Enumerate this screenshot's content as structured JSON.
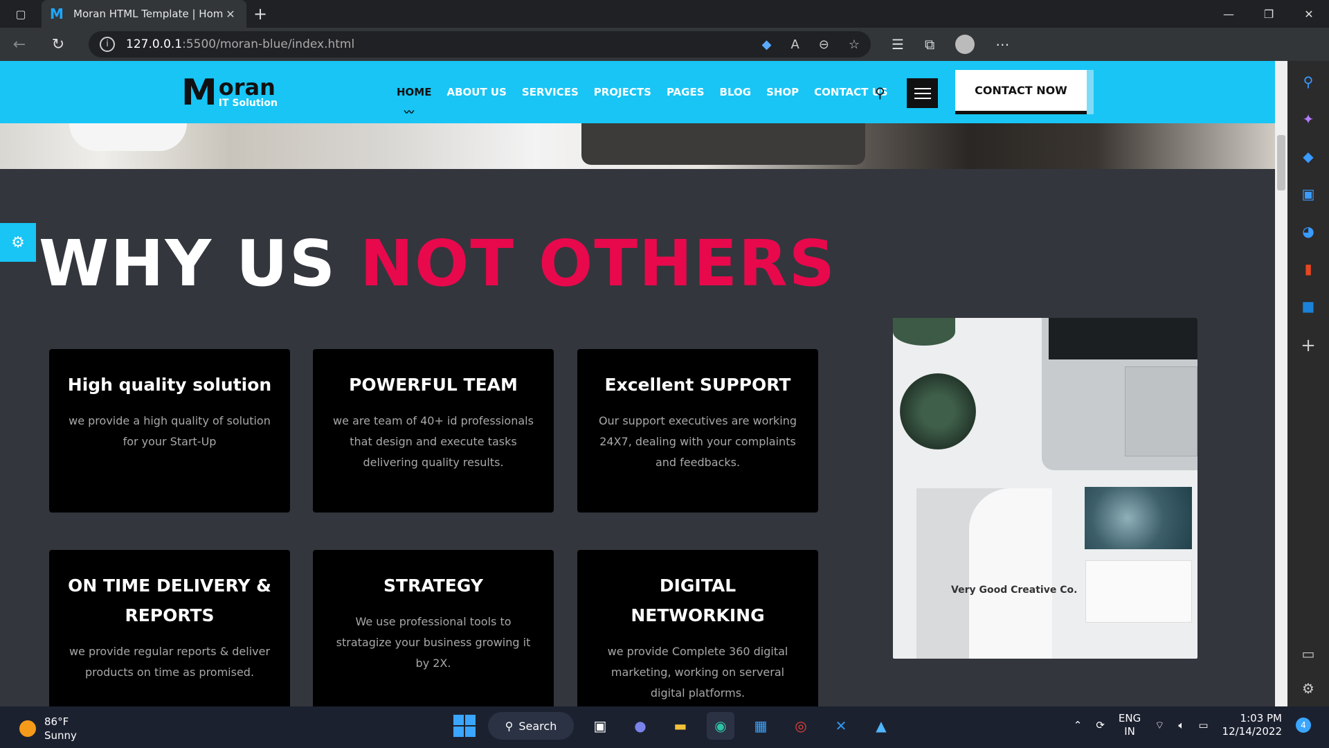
{
  "browser": {
    "tab_title": "Moran HTML Template | Homepa",
    "url_host": "127.0.0.1",
    "url_path": ":5500/moran-blue/index.html"
  },
  "site": {
    "brand": {
      "letter": "M",
      "name": "oran",
      "tagline": "IT Solution"
    },
    "nav": [
      "HOME",
      "ABOUT US",
      "SERVICES",
      "PROJECTS",
      "PAGES",
      "BLOG",
      "SHOP",
      "CONTACT US"
    ],
    "cta_label": "CONTACT NOW",
    "section_title_white": "WHY US ",
    "section_title_red": "NOT OTHERS",
    "cards": [
      {
        "title": "High quality solution",
        "text": "we provide a high quality of solution for your Start-Up"
      },
      {
        "title": "POWERFUL TEAM",
        "text": "we are team of 40+ id professionals that design and execute tasks delivering quality results."
      },
      {
        "title": "Excellent SUPPORT",
        "text": "Our support executives are working 24X7, dealing with your complaints and feedbacks."
      },
      {
        "title": "ON TIME DELIVERY & REPORTS",
        "text": "we provide regular reports & deliver products on time as promised."
      },
      {
        "title": "STRATEGY",
        "text": "We use professional tools to stratagize your business growing it by 2X."
      },
      {
        "title": "DIGITAL NETWORKING",
        "text": "we provide Complete 360 digital marketing, working on serveral digital platforms."
      }
    ],
    "image_text": "Very Good Creative Co."
  },
  "taskbar": {
    "temp": "86°F",
    "condition": "Sunny",
    "search_label": "Search",
    "lang_line1": "ENG",
    "lang_line2": "IN",
    "time": "1:03 PM",
    "date": "12/14/2022",
    "notif_count": "4"
  },
  "colors": {
    "accent": "#18c5f5",
    "highlight": "#e7094c"
  }
}
